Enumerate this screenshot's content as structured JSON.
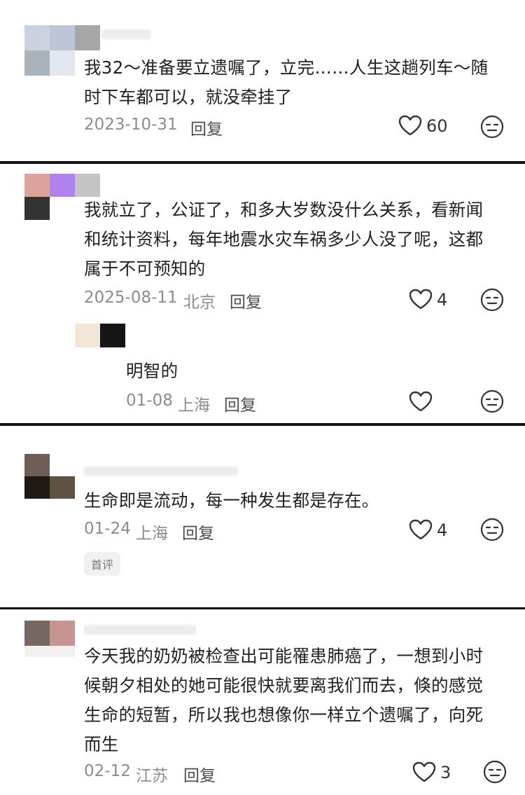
{
  "comments": [
    {
      "text_lines": [
        "我32～准备要立遗嘱了，立完……人生这趟列车～随",
        "时下车都可以，就没牵挂了"
      ],
      "date": "2023-10-31",
      "location": "",
      "reply_label": "回复",
      "likes": "60"
    },
    {
      "text_lines": [
        "我就立了，公证了，和多大岁数没什么关系，看新闻",
        "和统计资料，每年地震水灾车祸多少人没了呢，这都",
        "属于不可预知的"
      ],
      "date": "2025-08-11",
      "location": "北京",
      "reply_label": "回复",
      "likes": "4",
      "replies": [
        {
          "text_lines": [
            "明智的"
          ],
          "date": "01-08",
          "location": "上海",
          "reply_label": "回复",
          "likes": ""
        }
      ]
    },
    {
      "text_lines": [
        "生命即是流动，每一种发生都是存在。"
      ],
      "date": "01-24",
      "location": "上海",
      "reply_label": "回复",
      "likes": "4",
      "badge": "首评"
    },
    {
      "text_lines": [
        "今天我的奶奶被检查出可能罹患肺癌了，一想到小时",
        "候朝夕相处的她可能很快就要离我们而去，倏的感觉",
        "生命的短暂，所以我也想像你一样立个遗嘱了，向死",
        "而生"
      ],
      "date": "02-12",
      "location": "江苏",
      "reply_label": "回复",
      "likes": "3"
    }
  ],
  "icons": {
    "like": "heart-outline-icon",
    "dislike": "neutral-face-icon"
  },
  "colors": {
    "text": "#1f1f1f",
    "meta": "#8c8c8c",
    "divider": "#111111"
  }
}
